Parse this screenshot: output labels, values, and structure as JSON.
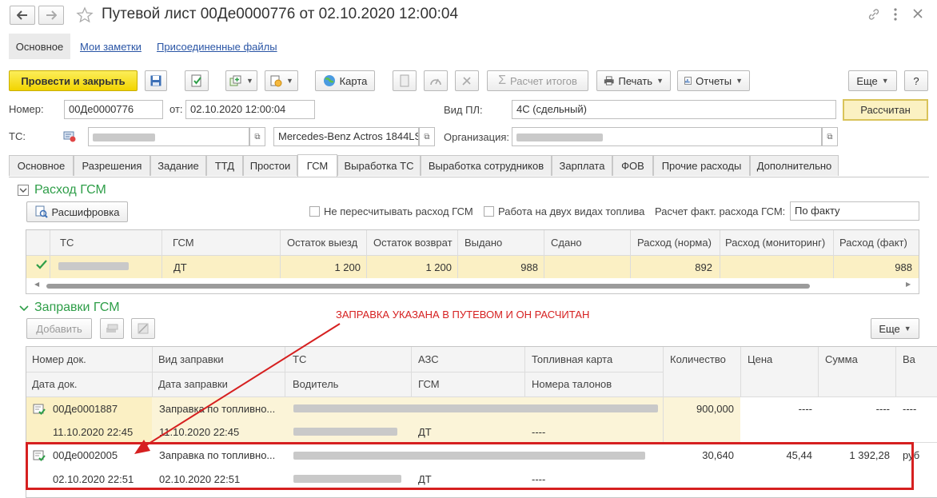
{
  "window": {
    "title": "Путевой лист 00Де0000776 от 02.10.2020 12:00:04"
  },
  "nav_tabs": [
    "Основное",
    "Мои заметки",
    "Присоединенные файлы"
  ],
  "toolbar": {
    "post_close": "Провести и закрыть",
    "map": "Карта",
    "calc_totals": "Расчет итогов",
    "print": "Печать",
    "reports": "Отчеты",
    "more": "Еще",
    "help": "?"
  },
  "header": {
    "number_label": "Номер:",
    "number_value": "00Де0000776",
    "date_label": "от:",
    "date_value": "02.10.2020 12:00:04",
    "type_label": "Вид ПЛ:",
    "type_value": "4С (сдельный)",
    "status_button": "Рассчитан",
    "ts_label": "ТС:",
    "ts_model": "Mercedes-Benz Actros 1844LS",
    "org_label": "Организация:"
  },
  "tabs": [
    "Основное",
    "Разрешения",
    "Задание",
    "ТТД",
    "Простои",
    "ГСМ",
    "Выработка ТС",
    "Выработка сотрудников",
    "Зарплата",
    "ФОВ",
    "Прочие расходы",
    "Дополнительно"
  ],
  "fuel_usage": {
    "title": "Расход ГСМ",
    "decode_button": "Расшифровка",
    "no_recalc": "Не пересчитывать расход ГСМ",
    "two_fuels": "Работа на двух видах топлива",
    "calc_label": "Расчет факт. расхода ГСМ:",
    "calc_value": "По факту",
    "columns": [
      "ТС",
      "ГСМ",
      "Остаток выезд",
      "Остаток возврат",
      "Выдано",
      "Сдано",
      "Расход (норма)",
      "Расход (мониторинг)",
      "Расход (факт)"
    ],
    "row": {
      "fuel": "ДТ",
      "start": "1 200",
      "return": "1 200",
      "issued": "988",
      "delivered": "",
      "norm": "892",
      "monitoring": "",
      "fact": "988"
    }
  },
  "refuels": {
    "title": "Заправки ГСМ",
    "add_button": "Добавить",
    "more": "Еще",
    "annotation": "ЗАПРАВКА УКАЗАНА В ПУТЕВОМ И ОН РАСЧИТАН",
    "columns_top": [
      "Номер док.",
      "Вид заправки",
      "ТС",
      "АЗС",
      "Топливная карта",
      "Количество",
      "Цена",
      "Сумма",
      "Ва"
    ],
    "columns_bottom": [
      "Дата док.",
      "Дата заправки",
      "Водитель",
      "ГСМ",
      "Номера талонов"
    ],
    "rows": [
      {
        "doc": "00Де0001887",
        "kind": "Заправка по топливно...",
        "date_doc": "11.10.2020 22:45",
        "date_fuel": "11.10.2020 22:45",
        "fuel": "ДТ",
        "talons": "----",
        "qty": "900,000",
        "price": "----",
        "sum": "----",
        "cur": "----"
      },
      {
        "doc": "00Де0002005",
        "kind": "Заправка по топливно...",
        "date_doc": "02.10.2020 22:51",
        "date_fuel": "02.10.2020 22:51",
        "fuel": "ДТ",
        "talons": "----",
        "qty": "30,640",
        "price": "45,44",
        "sum": "1 392,28",
        "cur": "руб"
      }
    ]
  },
  "colors": {
    "accent_green": "#2e9e48",
    "highlight_red": "#d62020",
    "selected_row": "#fbf0c4"
  }
}
